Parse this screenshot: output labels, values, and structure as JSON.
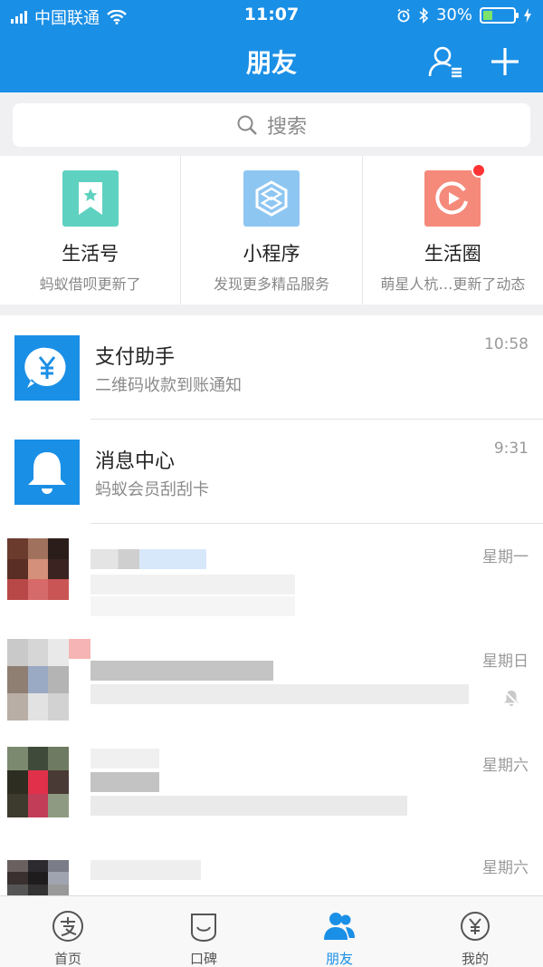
{
  "status_bar": {
    "carrier": "中国联通",
    "time": "11:07",
    "battery": "30%"
  },
  "header": {
    "title": "朋友"
  },
  "search": {
    "placeholder": "搜索"
  },
  "apps": [
    {
      "name": "生活号",
      "subtitle": "蚂蚁借呗更新了",
      "color": "#5fd1c0",
      "icon": "bookmark-star-icon"
    },
    {
      "name": "小程序",
      "subtitle": "发现更多精品服务",
      "color": "#8ec6f2",
      "icon": "hexagon-cube-icon"
    },
    {
      "name": "生活圈",
      "subtitle": "萌星人杭…更新了动态",
      "color": "#f58a7b",
      "icon": "play-circle-icon"
    }
  ],
  "messages": [
    {
      "title": "支付助手",
      "subtitle": "二维码收款到账通知",
      "time": "10:58",
      "icon": "yen-bubble-icon"
    },
    {
      "title": "消息中心",
      "subtitle": "蚂蚁会员刮刮卡",
      "time": "9:31",
      "icon": "bell-icon"
    }
  ],
  "contacts": [
    {
      "time": "星期一"
    },
    {
      "time": "星期日"
    },
    {
      "time": "星期六"
    },
    {
      "time": "星期六"
    }
  ],
  "tabbar": {
    "items": [
      {
        "label": "首页",
        "icon": "alipay-zhi-icon"
      },
      {
        "label": "口碑",
        "icon": "koubei-bag-icon"
      },
      {
        "label": "朋友",
        "icon": "friends-icon"
      },
      {
        "label": "我的",
        "icon": "wallet-yen-icon"
      }
    ]
  },
  "colors": {
    "primary": "#1a8fe6",
    "background": "#f0f0f2"
  }
}
